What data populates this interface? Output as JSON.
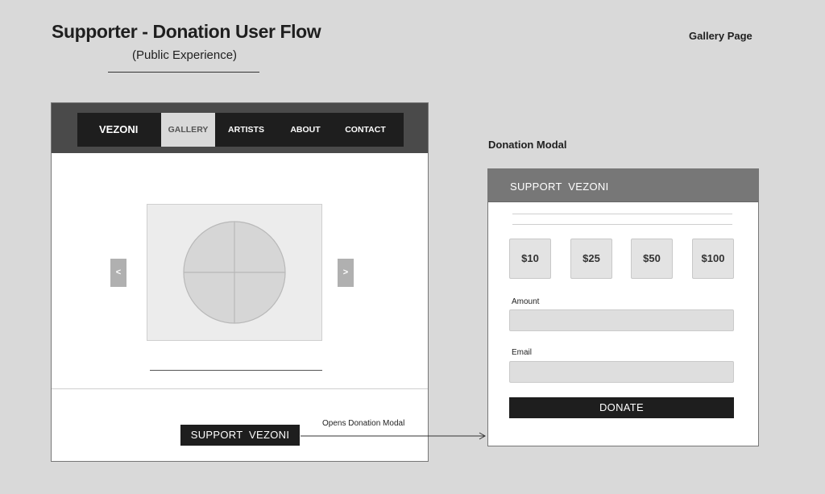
{
  "header": {
    "title": "Supporter - Donation User Flow",
    "subtitle": "(Public Experience)",
    "page_label": "Gallery Page"
  },
  "gallery_page": {
    "brand": "VEZONI",
    "nav_items": [
      {
        "label": "GALLERY",
        "active": true
      },
      {
        "label": "ARTISTS",
        "active": false
      },
      {
        "label": "ABOUT",
        "active": false
      },
      {
        "label": "CONTACT",
        "active": false
      }
    ],
    "prev_label": "<",
    "next_label": ">",
    "support_button": "SUPPORT  VEZONI"
  },
  "connector": {
    "label": "Opens Donation Modal"
  },
  "modal": {
    "label": "Donation Modal",
    "title": "SUPPORT  VEZONI",
    "amounts": [
      "$10",
      "$25",
      "$50",
      "$100"
    ],
    "amount_label": "Amount",
    "email_label": "Email",
    "donate_button": "DONATE"
  },
  "colors": {
    "background": "#d9d9d9",
    "header_dark": "#4a4a4a",
    "nav_dark": "#1e1e1e",
    "modal_header": "#777777",
    "placeholder": "#ececec"
  }
}
